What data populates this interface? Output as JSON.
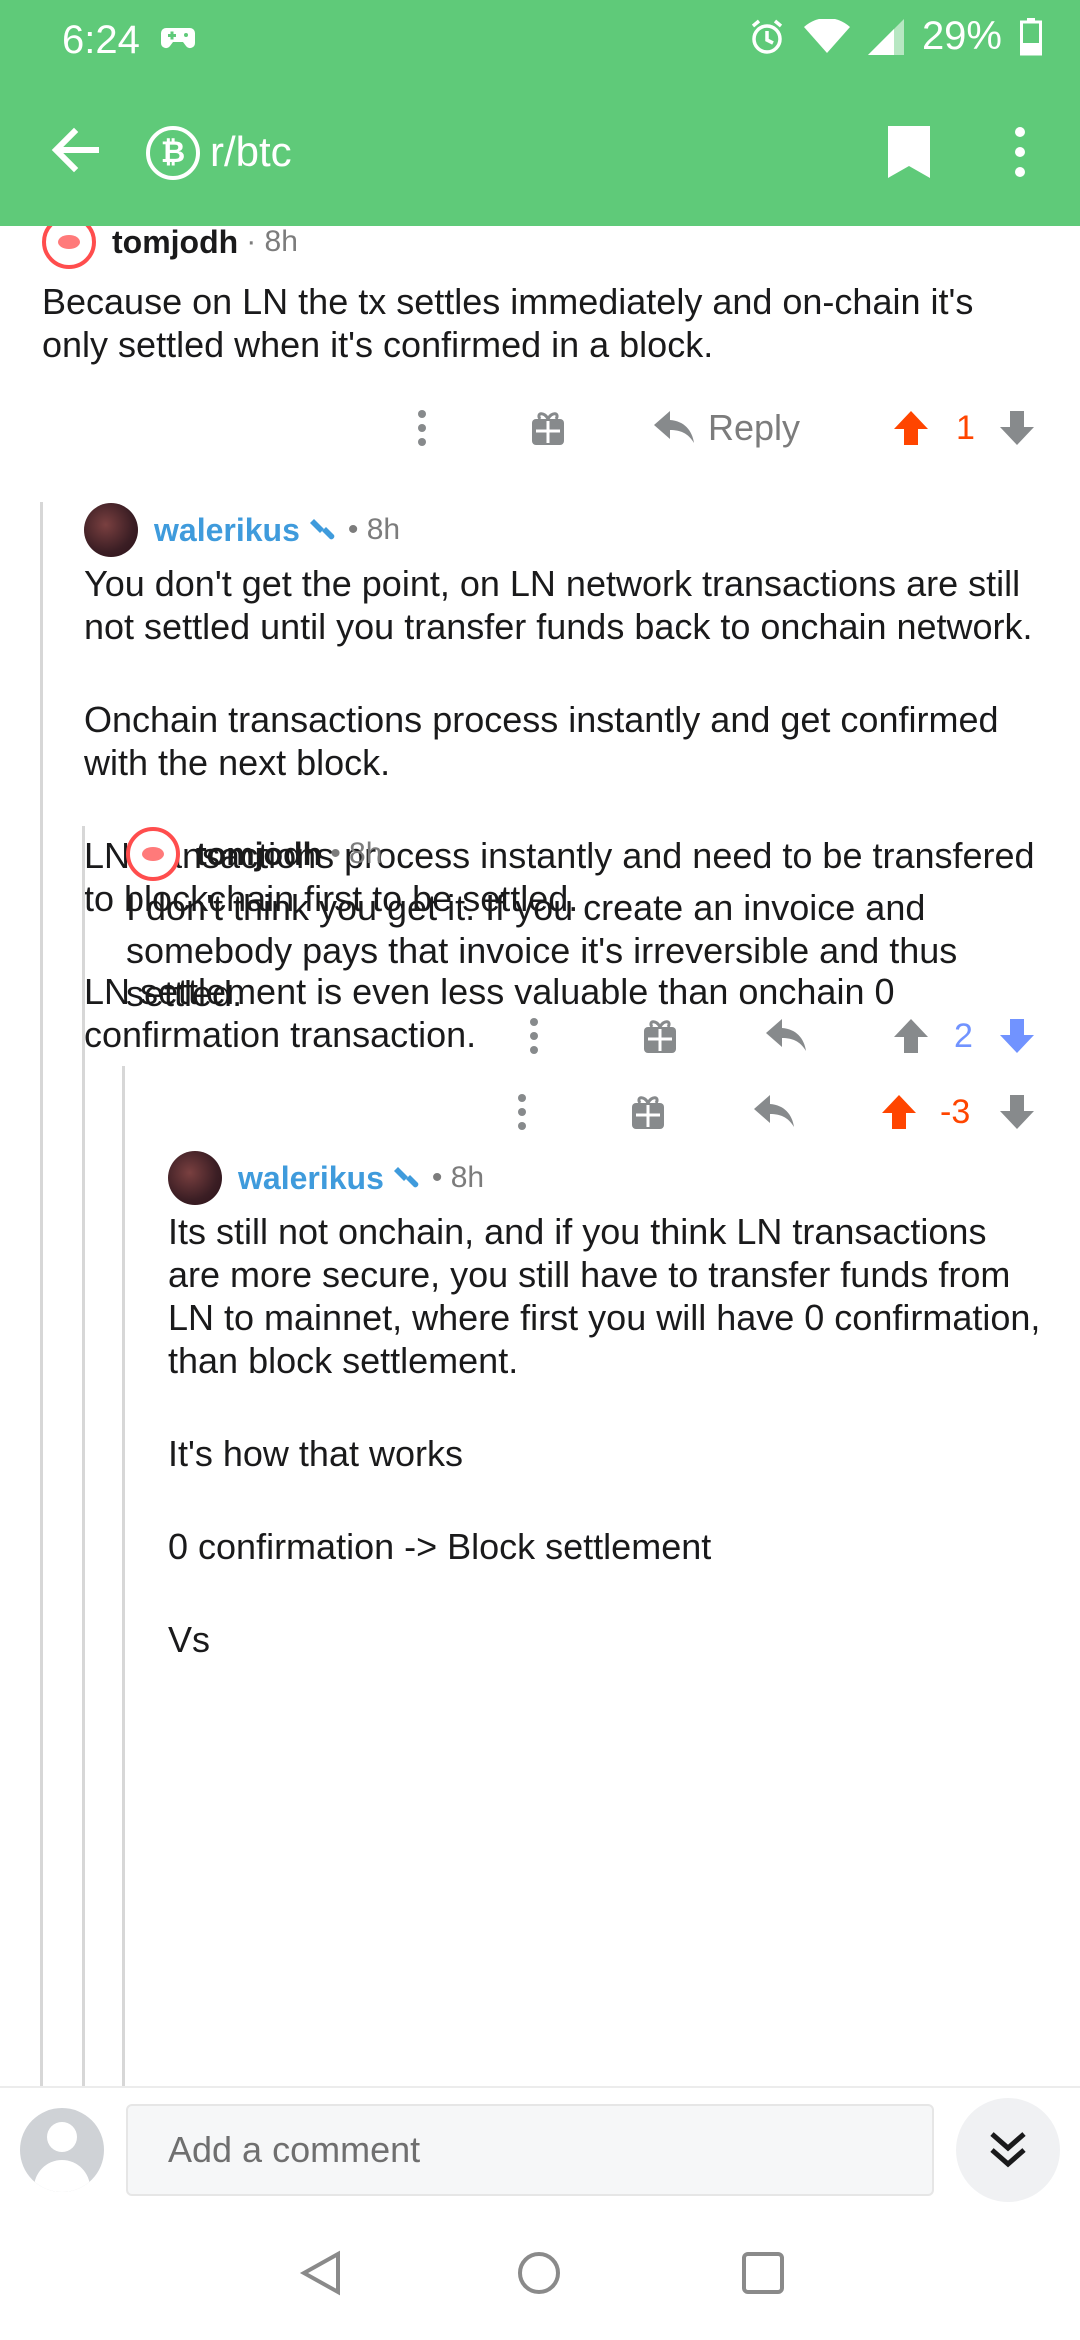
{
  "status_bar": {
    "time": "6:24",
    "battery": "29%"
  },
  "app_bar": {
    "subreddit": "r/btc",
    "subreddit_icon_letter": "₿"
  },
  "comments": [
    {
      "author": "tomjodh",
      "time": "8h",
      "paragraphs": [
        "Because on LN the tx settles immediately and on-chain it's only settled when it's confirmed in a block."
      ],
      "reply_label": "Reply",
      "score": "1"
    },
    {
      "author": "walerikus",
      "time": "8h",
      "paragraphs": [
        "You don't get the point, on LN network transactions are still not settled until you transfer funds back to onchain network.",
        "Onchain transactions process instantly and get confirmed with the next block.",
        "LN transactions process instantly and need to be transfered to blockchain first to be settled.",
        "LN settlement is even less valuable than onchain 0 confirmation transaction."
      ],
      "score": "2"
    },
    {
      "author": "tomjodh",
      "time": "8h",
      "paragraphs": [
        "I don't think you get it. If you create an invoice and somebody pays that invoice it's irreversible and thus settled."
      ],
      "score": "-3"
    },
    {
      "author": "walerikus",
      "time": "8h",
      "paragraphs": [
        "Its still not onchain, and if you think LN transactions are more secure, you still have to transfer funds from LN to mainnet, where first you will have 0 confirmation, than block settlement.",
        "It's how that works",
        "0 confirmation -> Block settlement",
        "Vs"
      ]
    }
  ],
  "comment_bar": {
    "placeholder": "Add a comment"
  },
  "colors": {
    "header": "#5fca79",
    "upvote": "#ff4500",
    "downvote": "#7193ff",
    "username_blue": "#3f9bdc"
  }
}
